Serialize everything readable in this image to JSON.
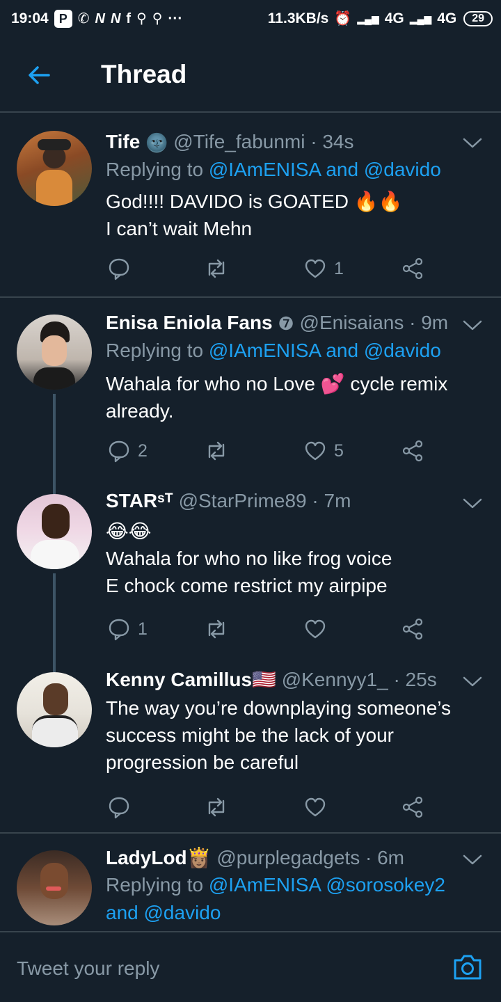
{
  "status_bar": {
    "time": "19:04",
    "net_speed": "11.3KB/s",
    "network_1": "4G",
    "network_2": "4G",
    "battery": "29",
    "more": "···"
  },
  "header": {
    "title": "Thread"
  },
  "tweets": [
    {
      "name": "Tife",
      "name_emoji": "🌚",
      "handle_time": "@Tife_fabunmi · 34s",
      "replying_prefix": "Replying to ",
      "replying_mentions": "@IAmENISA and @davido",
      "lines": [
        "God!!!! DAVIDO is GOATED 🔥🔥",
        "I can’t wait Mehn"
      ],
      "reply_count": "",
      "retweet_count": "",
      "like_count": "1"
    },
    {
      "name": "Enisa Eniola Fans",
      "name_emoji": "❼",
      "handle_time": "@Enisaians · 9m",
      "replying_prefix": "Replying to ",
      "replying_mentions": "@IAmENISA and @davido",
      "lines": [
        "Wahala for who no Love 💕 cycle remix",
        "already."
      ],
      "reply_count": "2",
      "retweet_count": "",
      "like_count": "5"
    },
    {
      "name": "STARˢᵀ",
      "handle_time": "@StarPrime89 · 7m",
      "lines": [
        "😂😂",
        "Wahala for who no like frog voice",
        "E chock come restrict my airpipe"
      ],
      "reply_count": "1",
      "retweet_count": "",
      "like_count": ""
    },
    {
      "name": "Kenny Camillus🇺🇸",
      "handle_time": "@Kennyy1_ · 25s",
      "lines": [
        "The way you’re downplaying someone’s",
        "success might be the lack of your",
        "progression be careful"
      ],
      "reply_count": "",
      "retweet_count": "",
      "like_count": ""
    },
    {
      "name": "LadyLod👸🏽",
      "handle_time": "@purplegadgets · 6m",
      "replying_prefix": "Replying to ",
      "replying_mentions": "@IAmENISA @sorosokey2",
      "replying_line2": "and @davido"
    }
  ],
  "reply_bar": {
    "placeholder": "Tweet your reply"
  },
  "colors": {
    "background": "#15202b",
    "accent": "#1da1f2",
    "muted": "#8899a6",
    "divider": "#38444d"
  },
  "icons": [
    "back-arrow-icon",
    "chevron-down-icon",
    "reply-icon",
    "retweet-icon",
    "like-icon",
    "share-icon",
    "camera-icon"
  ]
}
